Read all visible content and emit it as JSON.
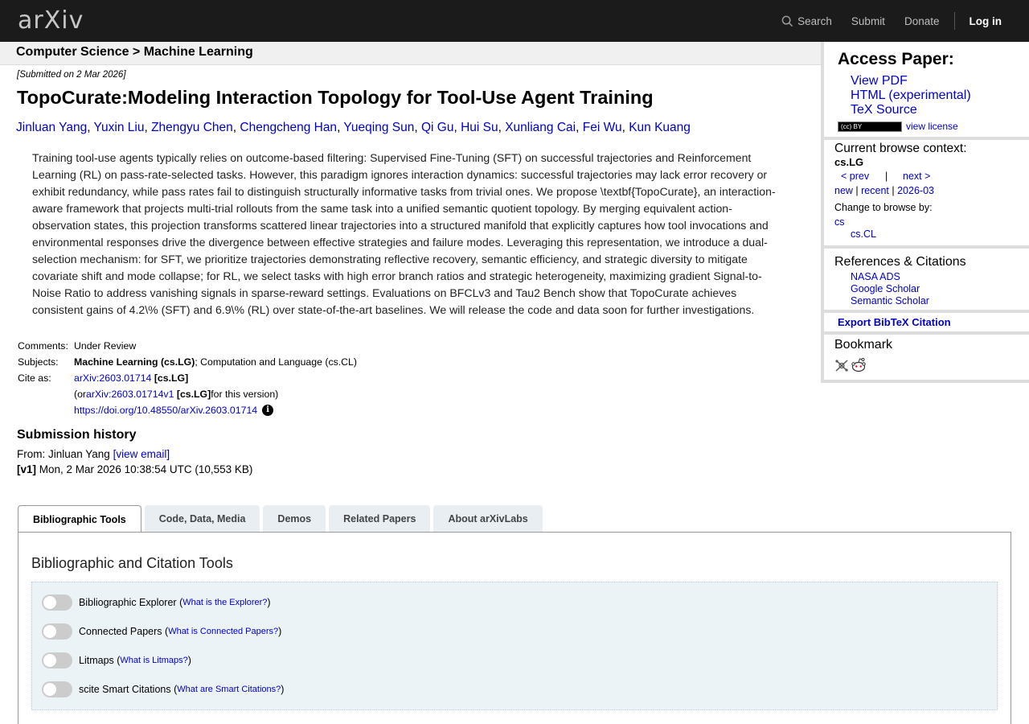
{
  "header": {
    "logo": "arXiv",
    "nav": {
      "search": "Search",
      "submit": "Submit",
      "donate": "Donate",
      "login": "Log in"
    }
  },
  "breadcrumb": "Computer Science > Machine Learning",
  "paper": {
    "submitted": "[Submitted on 2 Mar 2026]",
    "title": "TopoCurate:Modeling Interaction Topology for Tool-Use Agent Training",
    "authors": [
      "Jinluan Yang",
      "Yuxin Liu",
      "Zhengyu Chen",
      "Chengcheng Han",
      "Yueqing Sun",
      "Qi Gu",
      "Hui Su",
      "Xunliang Cai",
      "Fei Wu",
      "Kun Kuang"
    ],
    "abstract": "Training tool-use agents typically relies on outcome-based filtering: Supervised Fine-Tuning (SFT) on successful trajectories and Reinforcement Learning (RL) on pass-rate-selected tasks. However, this paradigm ignores interaction dynamics: successful trajectories may lack error recovery or exhibit redundancy, while pass rates fail to distinguish structurally informative tasks from trivial ones. We propose \\textbf{TopoCurate}, an interaction-aware framework that projects multi-trial rollouts from the same task into a unified semantic quotient topology. By merging equivalent action-observation states, this projection transforms scattered linear trajectories into a structured manifold that explicitly captures how tool invocations and environmental responses drive the divergence between effective strategies and failure modes. Leveraging this representation, we introduce a dual-selection mechanism: for SFT, we prioritize trajectories demonstrating reflective recovery, semantic efficiency, and strategic diversity to mitigate covariate shift and mode collapse; for RL, we select tasks with high error branch ratios and strategic heterogeneity, maximizing gradient Signal-to-Noise Ratio to address vanishing signals in sparse-reward settings. Evaluations on BFCLv3 and Tau2 Bench show that TopoCurate achieves consistent gains of 4.2\\% (SFT) and 6.9\\% (RL) over state-of-the-art baselines. We will release the code and data soon for further investigations."
  },
  "meta": {
    "comments_label": "Comments:",
    "comments": "Under Review",
    "subjects_label": "Subjects:",
    "subjects_primary": "Machine Learning (cs.LG)",
    "subjects_rest": "; Computation and Language (cs.CL)",
    "cite_label": "Cite as:",
    "cite_id": "arXiv:2603.01714",
    "cite_cat": "[cs.LG]",
    "or_prefix": "(or ",
    "cite_v1": "arXiv:2603.01714v1",
    "cite_v1_cat": "[cs.LG]",
    "or_suffix": " for this version)",
    "doi": "https://doi.org/10.48550/arXiv.2603.01714",
    "info_glyph": "i"
  },
  "history": {
    "title": "Submission history",
    "from_prefix": "From: Jinluan Yang ",
    "view_email": "[view email]",
    "v1_label": "[v1]",
    "v1_text": " Mon, 2 Mar 2026 10:38:54 UTC (10,553 KB)"
  },
  "tabs": [
    "Bibliographic Tools",
    "Code, Data, Media",
    "Demos",
    "Related Papers",
    "About arXivLabs"
  ],
  "panel": {
    "title": "Bibliographic and Citation Tools",
    "toggles": [
      {
        "label": "Bibliographic Explorer",
        "help": "What is the Explorer?"
      },
      {
        "label": "Connected Papers",
        "help": "What is Connected Papers?"
      },
      {
        "label": "Litmaps",
        "help": "What is Litmaps?"
      },
      {
        "label": "scite Smart Citations",
        "help": "What are Smart Citations?"
      }
    ]
  },
  "sidebar": {
    "access_title": "Access Paper:",
    "links": [
      "View PDF",
      "HTML (experimental)",
      "TeX Source"
    ],
    "cc_badge": "(cc) BY",
    "view_license": "view license",
    "context_label": "Current browse context:",
    "context": "cs.LG",
    "prev": "< prev",
    "pipe": "|",
    "next": "next >",
    "new": "new",
    "recent": "recent",
    "month": "2026-03",
    "change_label": "Change to browse by:",
    "browse_cs": "cs",
    "browse_cslg": "cs.CL",
    "refs_title": "References & Citations",
    "refs": [
      "NASA ADS",
      "Google Scholar",
      "Semantic Scholar"
    ],
    "export": "Export BibTeX Citation",
    "bookmark": "Bookmark"
  },
  "colors": {
    "link": "#0000cc",
    "topbar": "#1b1b1b",
    "logo_x": "#b31b1b"
  },
  "icons": {
    "search": "search-icon",
    "info": "info-icon",
    "bibsonomy": "bibsonomy-icon",
    "reddit": "reddit-icon"
  }
}
